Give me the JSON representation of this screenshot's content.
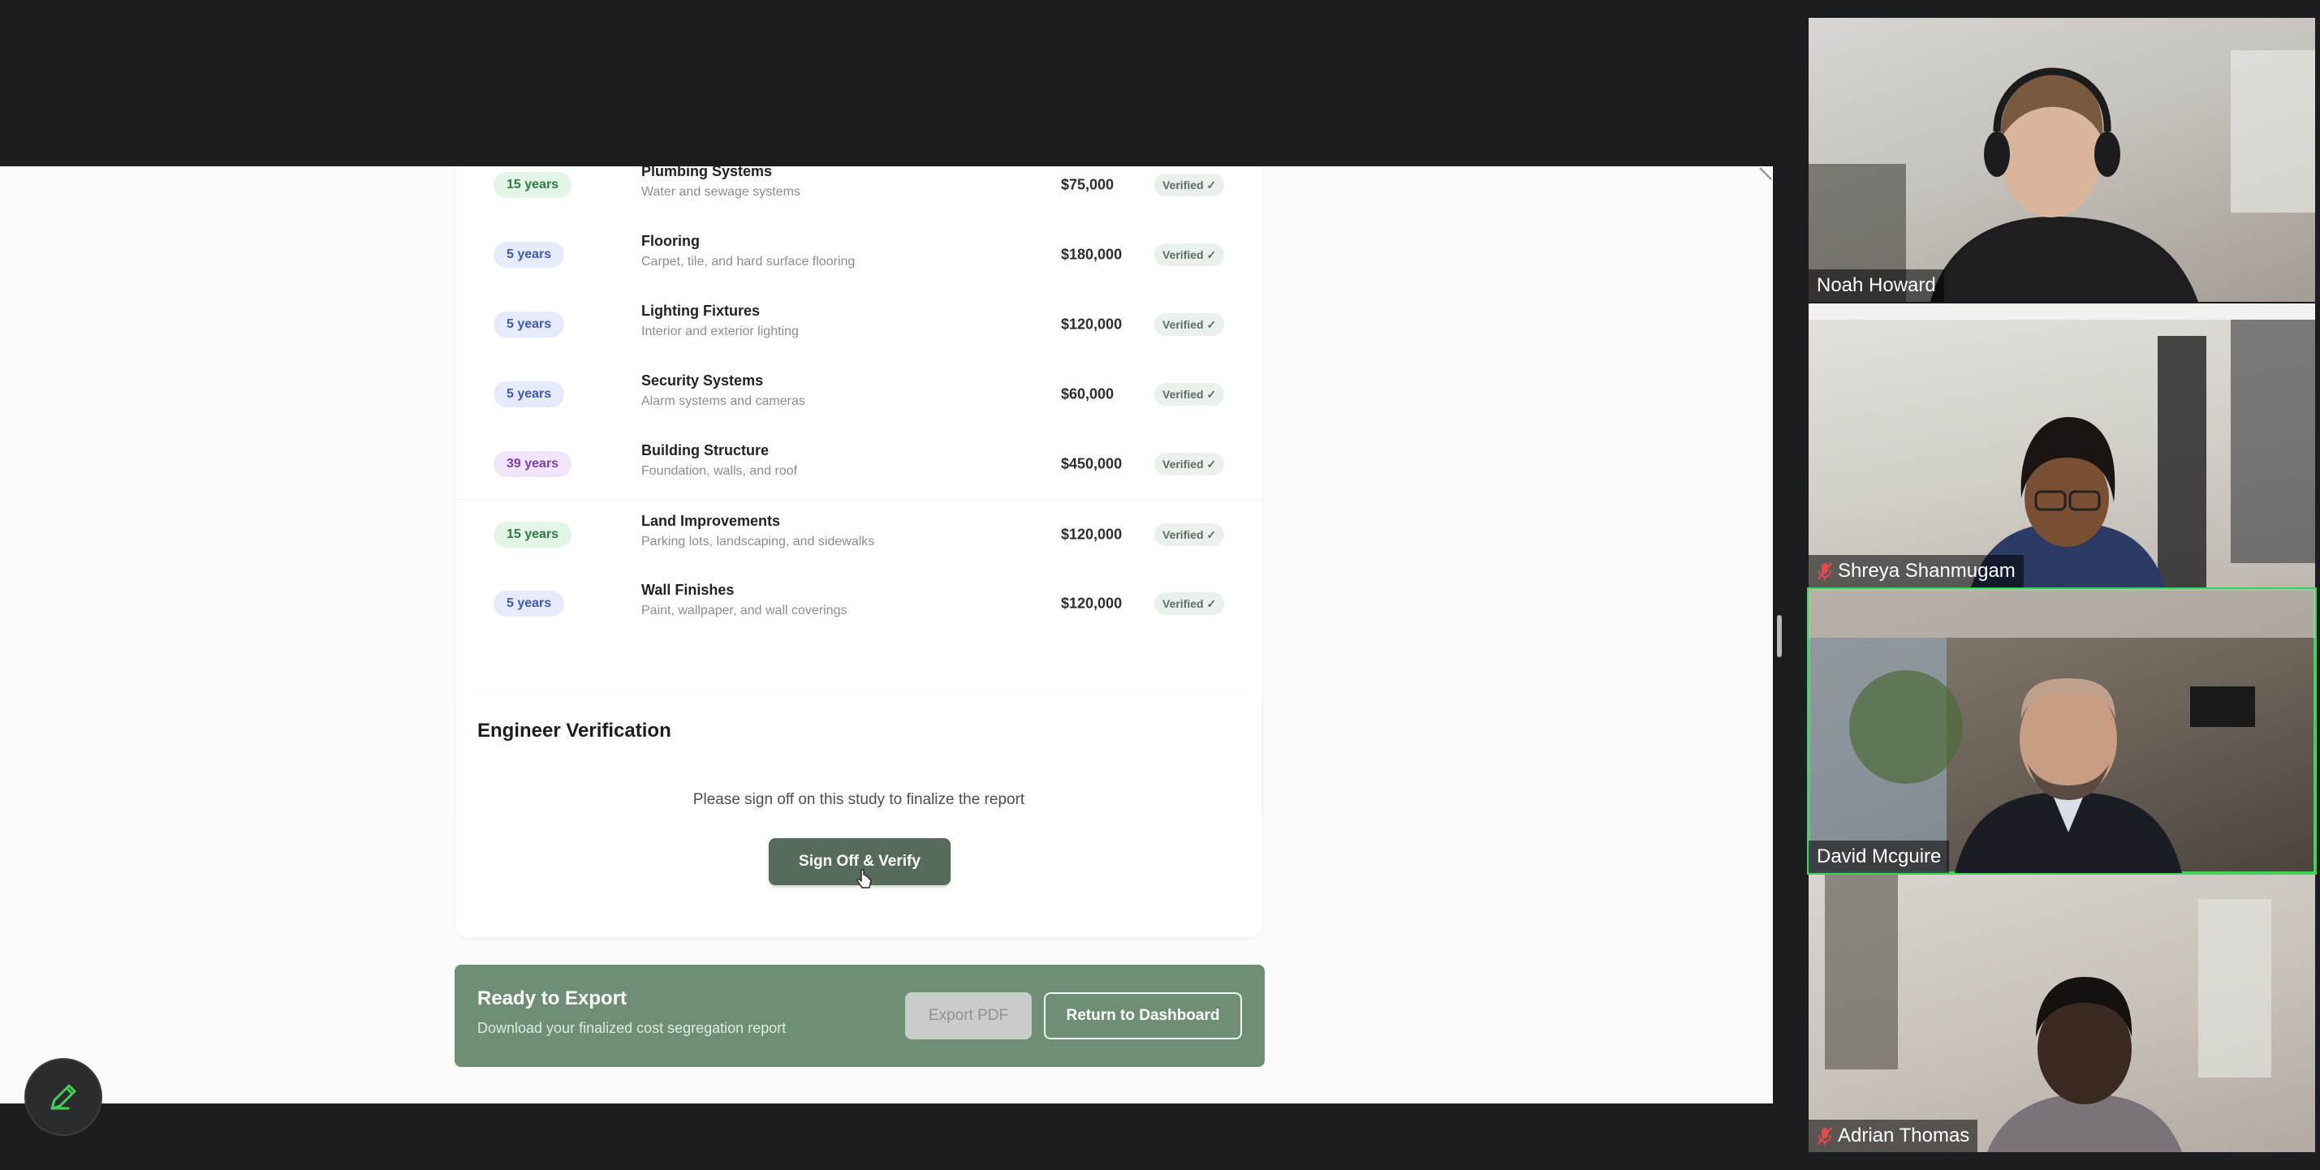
{
  "depreciation_table": {
    "rows": [
      {
        "life": "15 years",
        "life_color": "green",
        "name": "Plumbing Systems",
        "desc": "Water and sewage systems",
        "cost": "$75,000",
        "status": "Verified ✓"
      },
      {
        "life": "5 years",
        "life_color": "blue",
        "name": "Flooring",
        "desc": "Carpet, tile, and hard surface flooring",
        "cost": "$180,000",
        "status": "Verified ✓"
      },
      {
        "life": "5 years",
        "life_color": "blue",
        "name": "Lighting Fixtures",
        "desc": "Interior and exterior lighting",
        "cost": "$120,000",
        "status": "Verified ✓"
      },
      {
        "life": "5 years",
        "life_color": "blue",
        "name": "Security Systems",
        "desc": "Alarm systems and cameras",
        "cost": "$60,000",
        "status": "Verified ✓"
      },
      {
        "life": "39 years",
        "life_color": "purple",
        "name": "Building Structure",
        "desc": "Foundation, walls, and roof",
        "cost": "$450,000",
        "status": "Verified ✓"
      },
      {
        "life": "15 years",
        "life_color": "green",
        "name": "Land Improvements",
        "desc": "Parking lots, landscaping, and sidewalks",
        "cost": "$120,000",
        "status": "Verified ✓"
      },
      {
        "life": "5 years",
        "life_color": "blue",
        "name": "Wall Finishes",
        "desc": "Paint, wallpaper, and wall coverings",
        "cost": "$120,000",
        "status": "Verified ✓"
      }
    ]
  },
  "verification": {
    "title": "Engineer Verification",
    "prompt": "Please sign off on this study to finalize the report",
    "button_label": "Sign Off & Verify"
  },
  "export": {
    "title": "Ready to Export",
    "subtitle": "Download your finalized cost segregation report",
    "export_pdf_label": "Export PDF",
    "return_label": "Return to Dashboard"
  },
  "participants": [
    {
      "name": "Noah Howard",
      "muted": false,
      "active": false,
      "icon": "none"
    },
    {
      "name": "Shreya Shanmugam",
      "muted": true,
      "active": false,
      "icon": "mic-muted-icon"
    },
    {
      "name": "David Mcguire",
      "muted": false,
      "active": true,
      "icon": "none"
    },
    {
      "name": "Adrian Thomas",
      "muted": true,
      "active": false,
      "icon": "mic-muted-icon"
    }
  ],
  "colors": {
    "accent": "#566b5c",
    "export_bar": "#6e8f75",
    "active_speaker": "#3fd35a",
    "muted_icon": "#e5484d"
  }
}
